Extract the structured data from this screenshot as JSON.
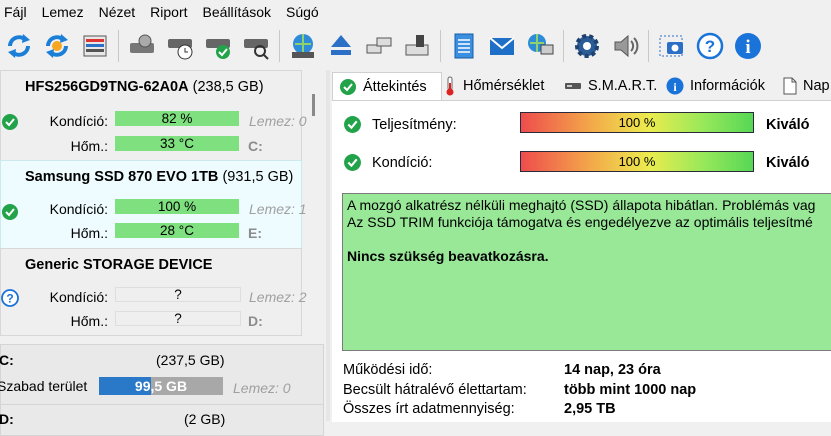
{
  "menu": [
    "Fájl",
    "Lemez",
    "Nézet",
    "Riport",
    "Beállítások",
    "Súgó"
  ],
  "drives": [
    {
      "name": "HFS256GD9TNG-62A0A",
      "size": "(238,5 GB)",
      "condition_label": "Kondíció:",
      "condition": "82 %",
      "temp_label": "Hőm.:",
      "temp": "33 °C",
      "extra": "Lemez: 0",
      "letter": "C:",
      "status": "ok"
    },
    {
      "name": "Samsung SSD 870 EVO 1TB",
      "size": "(931,5 GB)",
      "condition_label": "Kondíció:",
      "condition": "100 %",
      "temp_label": "Hőm.:",
      "temp": "28 °C",
      "extra": "Lemez: 1",
      "letter": "E:",
      "status": "ok"
    },
    {
      "name": "Generic STORAGE DEVICE",
      "size": "",
      "condition_label": "Kondíció:",
      "condition": "?",
      "temp_label": "Hőm.:",
      "temp": "?",
      "extra": "Lemez: 2",
      "letter": "D:",
      "status": "unknown"
    }
  ],
  "volumes": [
    {
      "letter": "C:",
      "size": "(237,5 GB)",
      "free_label": "Szabad terület",
      "free": "99,5 GB",
      "free_fraction": 0.42,
      "extra": "Lemez: 0"
    },
    {
      "letter": "D:",
      "size": "(2 GB)"
    }
  ],
  "tabs": [
    "Áttekintés",
    "Hőmérséklet",
    "S.M.A.R.T.",
    "Információk",
    "Nap"
  ],
  "metrics": [
    {
      "label": "Teljesítmény:",
      "percent": "100 %",
      "value": "Kiváló"
    },
    {
      "label": "Kondíció:",
      "percent": "100 %",
      "value": "Kiváló"
    }
  ],
  "message": {
    "line1": "A mozgó alkatrész nélküli meghajtó (SSD) állapota hibátlan. Problémás vag",
    "line2": "Az SSD TRIM funkciója támogatva és engedélyezve az optimális teljesítmé",
    "line3": "Nincs szükség beavatkozásra."
  },
  "stats": [
    {
      "label": "Működési idő:",
      "value": "14 nap, 23 óra"
    },
    {
      "label": "Becsült hátralévő élettartam:",
      "value": "több mint 1000 nap"
    },
    {
      "label": "Összes írt adatmennyiség:",
      "value": "2,95 TB"
    }
  ],
  "colors": {
    "green_bar": "#7ee07e",
    "message_bg": "#98e898",
    "selected_card": "#eefcff",
    "accent_blue": "#1a73d9"
  }
}
